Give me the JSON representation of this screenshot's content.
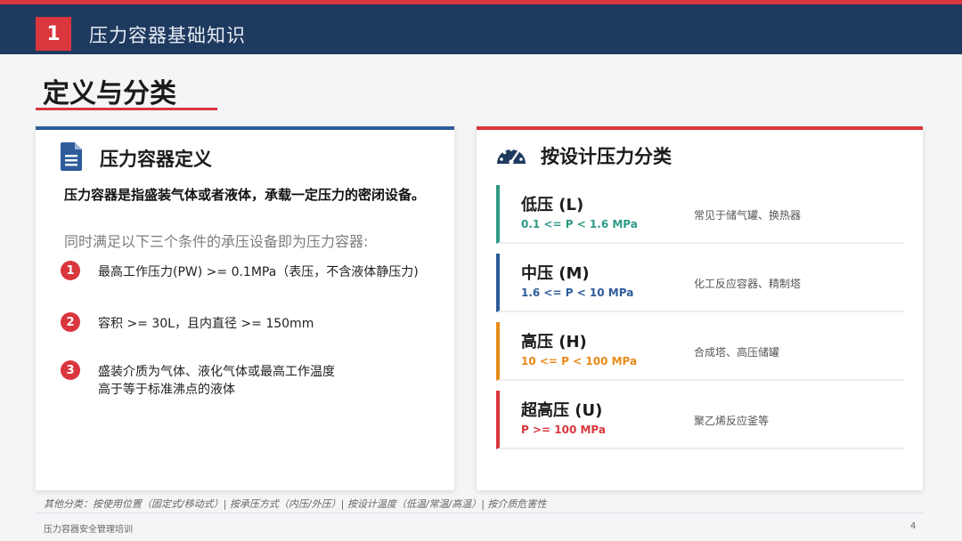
{
  "header": {
    "section_number": "1",
    "section_title": "压力容器基础知识",
    "colors": {
      "bar": "#1f3a5f",
      "accent": "#d9363e"
    }
  },
  "page": {
    "title": "定义与分类"
  },
  "definition_card": {
    "icon": "document-icon",
    "title": "压力容器定义",
    "definition": "压力容器是指盛装气体或者液体，承载一定压力的密闭设备。",
    "subtitle": "同时满足以下三个条件的承压设备即为压力容器:",
    "conditions": [
      {
        "num": "1",
        "line1": "最高工作压力(PW) >= 0.1MPa（表压，不含液体静压力)",
        "line2": ""
      },
      {
        "num": "2",
        "line1": "容积 >= 30L，且内直径 >= 150mm",
        "line2": ""
      },
      {
        "num": "3",
        "line1": "盛装介质为气体、液化气体或最高工作温度",
        "line2": "高于等于标准沸点的液体"
      }
    ]
  },
  "classification_card": {
    "icon": "gauge-icon",
    "title": "按设计压力分类",
    "items": [
      {
        "name": "低压 (L)",
        "range": "0.1 <= P < 1.6 MPa",
        "example": "常见于储气罐、换热器",
        "color": "#2e9a86"
      },
      {
        "name": "中压 (M)",
        "range": "1.6 <= P < 10 MPa",
        "example": "化工反应容器、精制塔",
        "color": "#2e5c9a"
      },
      {
        "name": "高压 (H)",
        "range": "10 <= P < 100 MPa",
        "example": "合成塔、高压储罐",
        "color": "#e88a1a"
      },
      {
        "name": "超高压 (U)",
        "range": "P >= 100 MPa",
        "example": "聚乙烯反应釜等",
        "color": "#d9363e"
      }
    ]
  },
  "footnote": "其他分类：按使用位置（固定式/移动式）| 按承压方式（内压/外压）| 按设计温度（低温/常温/高温）| 按介质危害性",
  "footer": {
    "left": "压力容器安全管理培训",
    "page_number": "4"
  }
}
